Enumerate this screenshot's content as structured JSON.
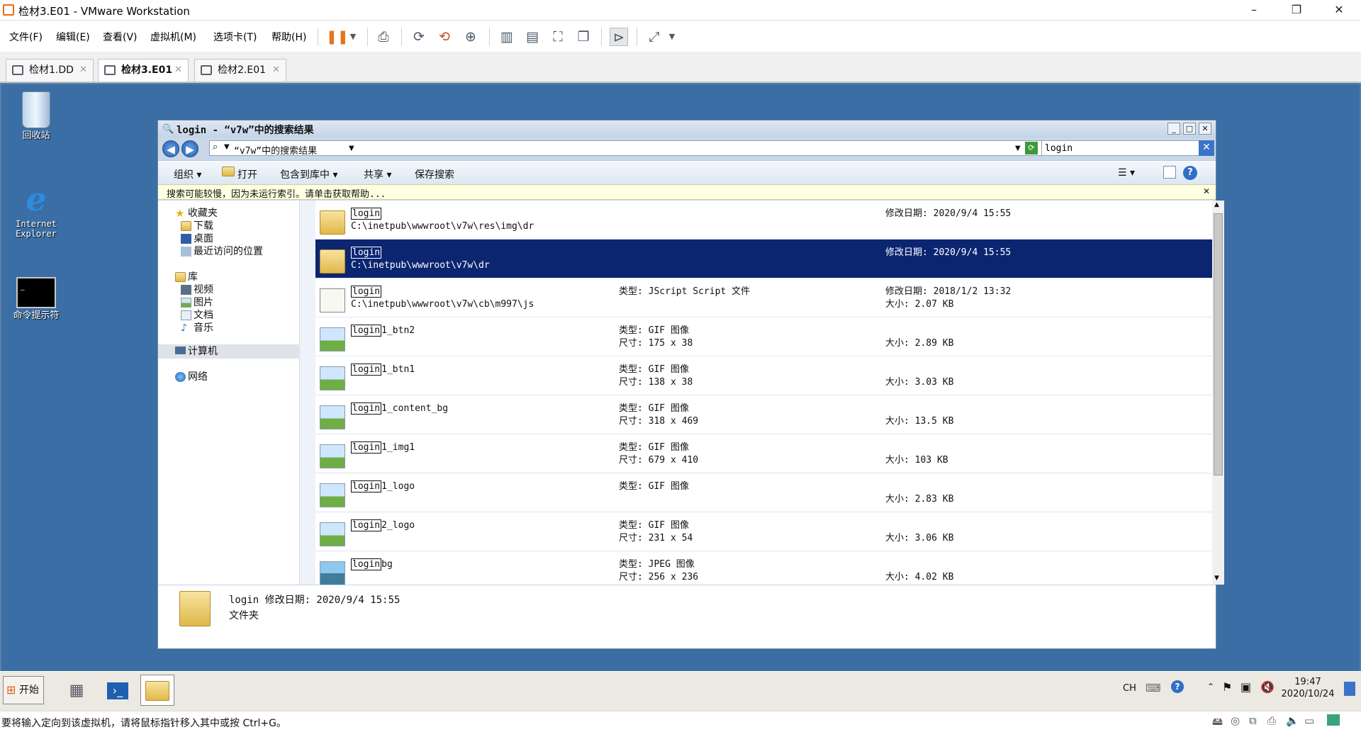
{
  "app": {
    "title": "检材3.E01 - VMware Workstation"
  },
  "menu": [
    "文件(F)",
    "编辑(E)",
    "查看(V)",
    "虚拟机(M)",
    "选项卡(T)",
    "帮助(H)"
  ],
  "tabs": [
    {
      "label": "检材1.DD",
      "active": false
    },
    {
      "label": "检材3.E01",
      "active": true
    },
    {
      "label": "检材2.E01",
      "active": false
    }
  ],
  "desktop": [
    {
      "label": "回收站",
      "icon": "recycle-bin-icon"
    },
    {
      "label": "Internet Explorer",
      "icon": "internet-explorer-icon"
    },
    {
      "label": "命令提示符",
      "icon": "command-prompt-icon"
    }
  ],
  "explorer": {
    "title": "login - “v7w”中的搜索结果",
    "address": "“v7w”中的搜索结果",
    "search_value": "login",
    "commands": {
      "organize": "组织",
      "open": "打开",
      "include": "包含到库中",
      "share": "共享",
      "save_search": "保存搜索"
    },
    "infobar": "搜索可能较慢，因为未运行索引。请单击获取帮助...",
    "nav": {
      "favorites": "收藏夹",
      "downloads": "下载",
      "desktop": "桌面",
      "recent": "最近访问的位置",
      "libraries": "库",
      "videos": "视频",
      "pictures": "图片",
      "documents": "文档",
      "music": "音乐",
      "computer": "计算机",
      "network": "网络"
    },
    "results": [
      {
        "hl": "login",
        "rest": "",
        "path": "C:\\inetpub\\wwwroot\\v7w\\res\\img\\dr",
        "type": "",
        "dim": "",
        "mod": "修改日期: 2020/9/4 15:55",
        "size": "",
        "icon": "folder"
      },
      {
        "hl": "login",
        "rest": "",
        "path": "C:\\inetpub\\wwwroot\\v7w\\dr",
        "type": "",
        "dim": "",
        "mod": "修改日期: 2020/9/4 15:55",
        "size": "",
        "icon": "folder",
        "selected": true
      },
      {
        "hl": "login",
        "rest": "",
        "path": "C:\\inetpub\\wwwroot\\v7w\\cb\\m997\\js",
        "type": "类型: JScript Script 文件",
        "dim": "",
        "mod": "修改日期: 2018/1/2 13:32",
        "size": "大小: 2.07 KB",
        "icon": "js"
      },
      {
        "hl": "login",
        "rest": "1_btn2",
        "path": "",
        "type": "类型: GIF 图像",
        "dim": "尺寸: 175 x 38",
        "mod": "",
        "size": "大小: 2.89 KB",
        "icon": "gif"
      },
      {
        "hl": "login",
        "rest": "1_btn1",
        "path": "",
        "type": "类型: GIF 图像",
        "dim": "尺寸: 138 x 38",
        "mod": "",
        "size": "大小: 3.03 KB",
        "icon": "gif"
      },
      {
        "hl": "login",
        "rest": "1_content_bg",
        "path": "",
        "type": "类型: GIF 图像",
        "dim": "尺寸: 318 x 469",
        "mod": "",
        "size": "大小: 13.5 KB",
        "icon": "gif"
      },
      {
        "hl": "login",
        "rest": "1_img1",
        "path": "",
        "type": "类型: GIF 图像",
        "dim": "尺寸: 679 x 410",
        "mod": "",
        "size": "大小: 103 KB",
        "icon": "gif"
      },
      {
        "hl": "login",
        "rest": "1_logo",
        "path": "",
        "type": "类型: GIF 图像",
        "dim": "",
        "mod": "",
        "size": "大小: 2.83 KB",
        "icon": "gif"
      },
      {
        "hl": "login",
        "rest": "2_logo",
        "path": "",
        "type": "类型: GIF 图像",
        "dim": "尺寸: 231 x 54",
        "mod": "",
        "size": "大小: 3.06 KB",
        "icon": "gif"
      },
      {
        "hl": "login",
        "rest": "bg",
        "path": "",
        "type": "类型: JPEG 图像",
        "dim": "尺寸: 256 x 236",
        "mod": "",
        "size": "大小: 4.02 KB",
        "icon": "jpg"
      }
    ],
    "details": {
      "line1": "login 修改日期: 2020/9/4 15:55",
      "line2": "文件夹"
    }
  },
  "guest_taskbar": {
    "start": "开始",
    "lang": "CH",
    "time": "19:47",
    "date": "2020/10/24"
  },
  "statusbar": "要将输入定向到该虚拟机，请将鼠标指针移入其中或按 Ctrl+G。"
}
